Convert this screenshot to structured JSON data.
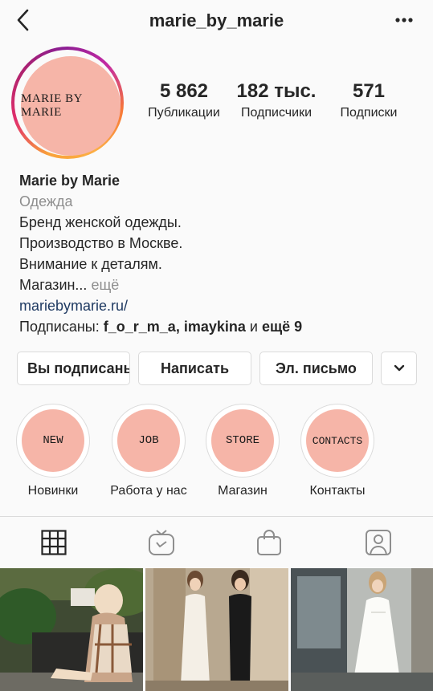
{
  "header": {
    "username": "marie_by_marie",
    "back_icon": "chevron-left-icon",
    "more_icon": "more-horizontal-icon"
  },
  "avatar": {
    "text": "MARIE BY MARIE",
    "color": "#f6b5a8"
  },
  "stats": [
    {
      "value": "5 862",
      "label": "Публикации"
    },
    {
      "value": "182 тыс.",
      "label": "Подписчики"
    },
    {
      "value": "571",
      "label": "Подписки"
    }
  ],
  "bio": {
    "name": "Marie by Marie",
    "category": "Одежда",
    "lines": [
      "Бренд женской одежды.",
      "Производство в Москве.",
      "Внимание к деталям."
    ],
    "truncated": "Магазин...",
    "more": "ещё",
    "link": "mariebymarie.ru/",
    "followed_prefix": "Подписаны:",
    "followed_users": "f_o_r_m_a, imaykina",
    "followed_and": "и",
    "followed_more": "ещё 9"
  },
  "buttons": {
    "following": "Вы подписаны",
    "message": "Написать",
    "email": "Эл. письмо",
    "dropdown_icon": "chevron-down-icon"
  },
  "highlights": [
    {
      "cover": "NEW",
      "label": "Новинки"
    },
    {
      "cover": "JOB",
      "label": "Работа у нас"
    },
    {
      "cover": "STORE",
      "label": "Магазин"
    },
    {
      "cover": "CONTACTS",
      "label": "Контакты"
    }
  ],
  "tabs": [
    {
      "icon": "grid-icon",
      "active": true
    },
    {
      "icon": "igtv-icon",
      "active": false
    },
    {
      "icon": "shopping-bag-icon",
      "active": false
    },
    {
      "icon": "tagged-icon",
      "active": false
    }
  ],
  "colors": {
    "accent_link": "#1f3a62",
    "muted": "#8e8e8e",
    "highlight_fill": "#f6b5a8"
  }
}
